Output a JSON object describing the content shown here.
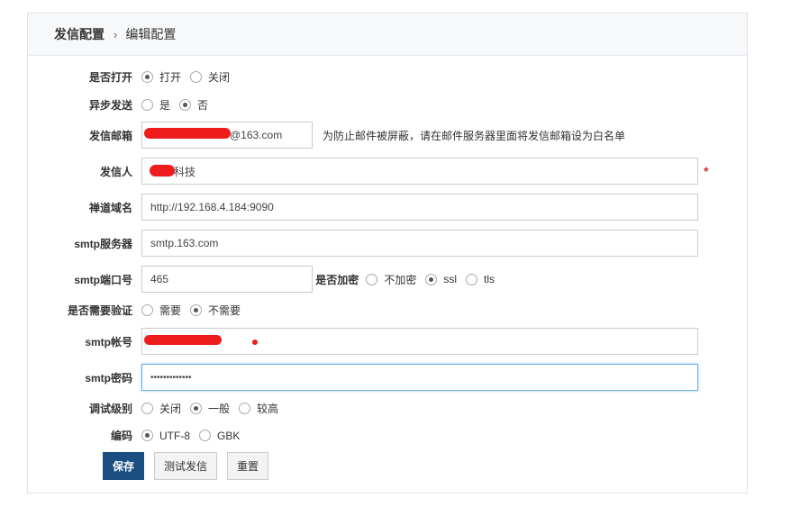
{
  "breadcrumb": {
    "root": "发信配置",
    "sep": "›",
    "current": "编辑配置"
  },
  "form": {
    "enable": {
      "label": "是否打开",
      "options": [
        "打开",
        "关闭"
      ],
      "selected": 0
    },
    "async": {
      "label": "异步发送",
      "options": [
        "是",
        "否"
      ],
      "selected": 1
    },
    "sender_email": {
      "label": "发信邮箱",
      "value": "@163.com",
      "hint": "为防止邮件被屏蔽，请在邮件服务器里面将发信邮箱设为白名单"
    },
    "sender_name": {
      "label": "发信人",
      "value": "科技",
      "required": "*"
    },
    "domain": {
      "label": "禅道域名",
      "value": "http://192.168.4.184:9090"
    },
    "smtp_server": {
      "label": "smtp服务器",
      "value": "smtp.163.com"
    },
    "smtp_port": {
      "label": "smtp端口号",
      "value": "465"
    },
    "encrypt": {
      "label": "是否加密",
      "options": [
        "不加密",
        "ssl",
        "tls"
      ],
      "selected": 1
    },
    "auth": {
      "label": "是否需要验证",
      "options": [
        "需要",
        "不需要"
      ],
      "selected": 1
    },
    "smtp_account": {
      "label": "smtp帐号",
      "value": ""
    },
    "smtp_password": {
      "label": "smtp密码",
      "value": "•••••••••••••"
    },
    "debug": {
      "label": "调试级别",
      "options": [
        "关闭",
        "一般",
        "较高"
      ],
      "selected": 1
    },
    "charset": {
      "label": "编码",
      "options": [
        "UTF-8",
        "GBK"
      ],
      "selected": 0
    }
  },
  "buttons": {
    "save": "保存",
    "test": "测试发信",
    "reset": "重置"
  },
  "colors": {
    "primary": "#1a4e80",
    "focus_border": "#66afe9",
    "required": "#d0312d"
  }
}
